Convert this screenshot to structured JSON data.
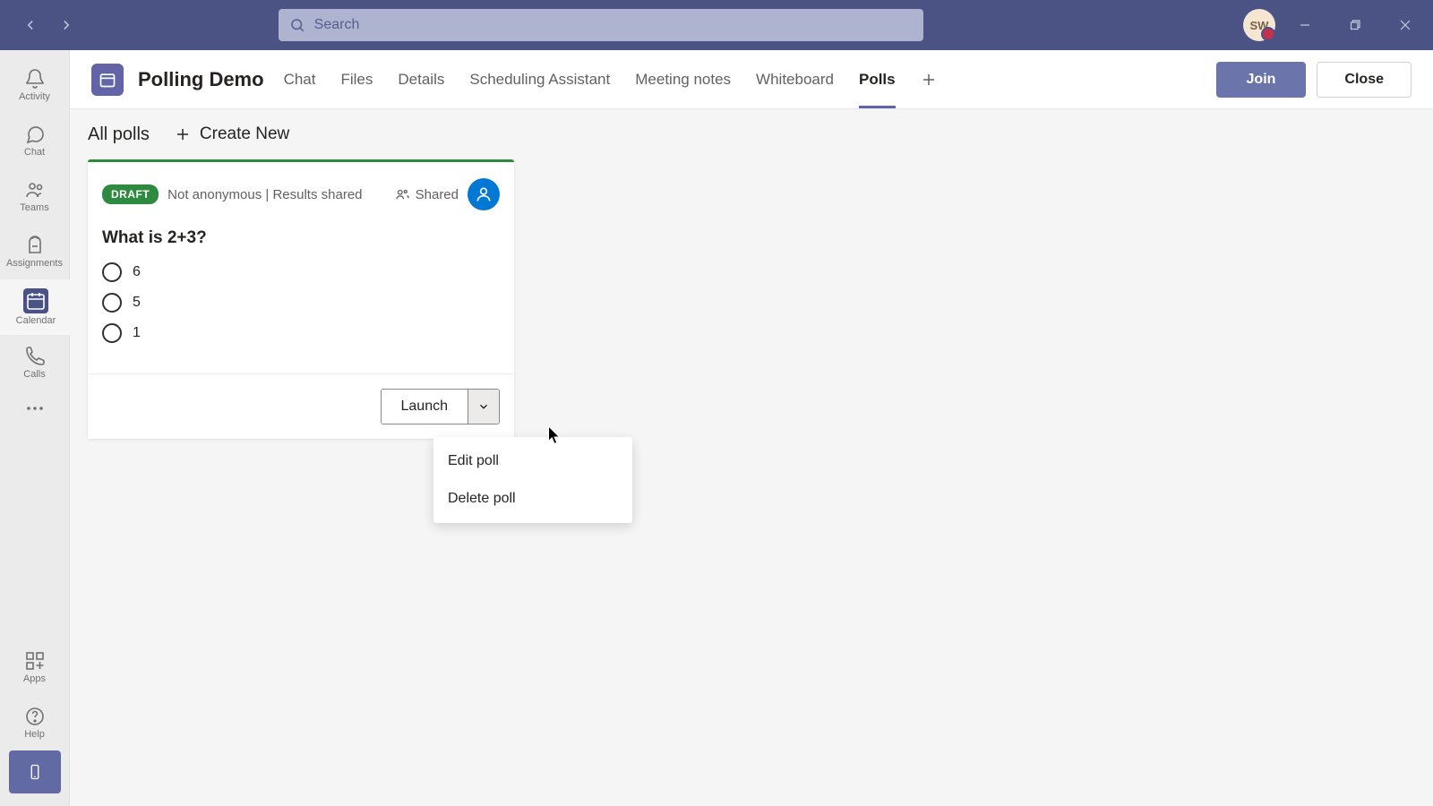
{
  "titlebar": {
    "search_placeholder": "Search",
    "avatar_initials": "SW"
  },
  "rail": {
    "activity": "Activity",
    "chat": "Chat",
    "teams": "Teams",
    "assignments": "Assignments",
    "calendar": "Calendar",
    "calls": "Calls",
    "apps": "Apps",
    "help": "Help"
  },
  "header": {
    "meeting_title": "Polling Demo",
    "tabs": {
      "chat": "Chat",
      "files": "Files",
      "details": "Details",
      "scheduling": "Scheduling Assistant",
      "notes": "Meeting notes",
      "whiteboard": "Whiteboard",
      "polls": "Polls"
    },
    "join": "Join",
    "close": "Close"
  },
  "polls": {
    "all_polls": "All polls",
    "create_new": "Create New",
    "card": {
      "draft_label": "DRAFT",
      "meta": "Not anonymous | Results shared",
      "shared": "Shared",
      "question": "What is 2+3?",
      "options": [
        "6",
        "5",
        "1"
      ],
      "launch": "Launch"
    },
    "dropdown": {
      "edit": "Edit poll",
      "delete": "Delete poll"
    }
  }
}
